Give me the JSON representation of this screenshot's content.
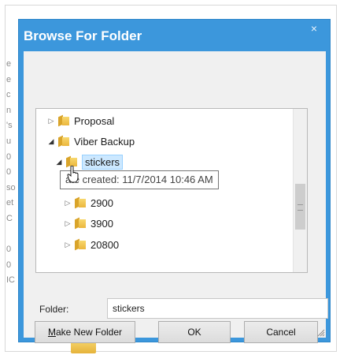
{
  "background": {
    "side_letters": [
      "e",
      "e",
      "c",
      "n",
      "'s",
      "u",
      "0",
      "0",
      "so",
      "et",
      "C",
      "",
      "0",
      "0",
      "IC"
    ]
  },
  "dialog": {
    "title": "Browse For Folder",
    "close_glyph": "×",
    "tree": {
      "items": [
        {
          "label": "Proposal",
          "expander": "▷"
        },
        {
          "label": "Viber Backup",
          "expander": "◢"
        },
        {
          "label": "stickers",
          "expander": "◢"
        },
        {
          "label": "2900",
          "expander": "▷"
        },
        {
          "label": "3900",
          "expander": "▷"
        },
        {
          "label": "20800",
          "expander": "▷"
        }
      ],
      "tooltip": "Date created: 11/7/2014 10:46 AM",
      "tooltip_visible": "ate created: 11/7/2014 10:46 AM"
    },
    "folder_label": "Folder:",
    "folder_value": "stickers",
    "buttons": {
      "make_new_folder_accel": "M",
      "make_new_folder_rest": "ake New Folder",
      "ok": "OK",
      "cancel": "Cancel"
    },
    "accent_color": "#3c97dc"
  }
}
